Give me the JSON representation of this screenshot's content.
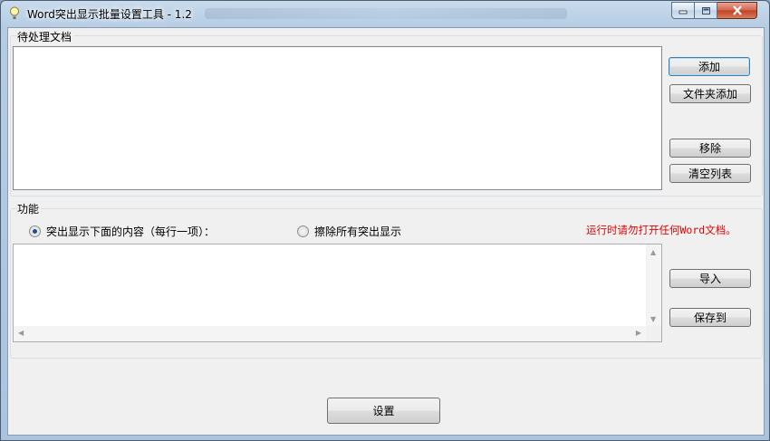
{
  "window": {
    "title": "Word突出显示批量设置工具 - 1.2",
    "accent_color": "#3c7fb1"
  },
  "docs_group": {
    "label": "待处理文档",
    "buttons": {
      "add": "添加",
      "add_folder": "文件夹添加",
      "remove": "移除",
      "clear": "清空列表"
    }
  },
  "function_group": {
    "label": "功能",
    "options": {
      "highlight": "突出显示下面的内容（每行一项）：",
      "clear_all": "擦除所有突出显示"
    },
    "selected_option": "highlight",
    "warning": "运行时请勿打开任何Word文档。",
    "warning_color": "#e00000",
    "buttons": {
      "import": "导入",
      "save_to": "保存到"
    }
  },
  "footer": {
    "settings_button": "设置"
  },
  "icons": {
    "app": "lightbulb-icon",
    "minimize": "minimize-icon",
    "maximize": "maximize-icon",
    "close": "close-icon"
  }
}
